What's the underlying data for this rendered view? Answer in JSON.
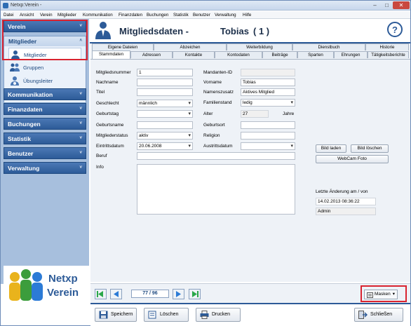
{
  "window": {
    "title": "Netxp:Verein -"
  },
  "menu": [
    "Datei",
    "Ansicht",
    "Verein",
    "Mitglieder",
    "Kommunikation",
    "Finanzdaten",
    "Buchungen",
    "Statistik",
    "Benutzer",
    "Verwaltung",
    "Hilfe"
  ],
  "sidebar": {
    "sections": [
      "Verein",
      "Mitglieder",
      "Kommunikation",
      "Finanzdaten",
      "Buchungen",
      "Statistik",
      "Benutzer",
      "Verwaltung"
    ],
    "mitglieder_items": [
      "Mitglieder",
      "Gruppen",
      "Übungsleiter"
    ],
    "chevron_up": "˄",
    "chevron_down": "˅"
  },
  "logo": {
    "line1": "Netxp",
    "line2": "Verein"
  },
  "header": {
    "title": "Mitgliedsdaten -",
    "name": "Tobias",
    "number": "( 1      )",
    "help": "?"
  },
  "tabs": {
    "row1": [
      "Eigene Dateien",
      "Abzeichen",
      "Weiterbildung",
      "Dienstbuch",
      "Historie"
    ],
    "row2": [
      "Stammdaten",
      "Adressen",
      "Kontakte",
      "Kontodaten",
      "Beiträge",
      "Sparten",
      "Ehrungen",
      "Tätigkeitsberichte"
    ],
    "active": "Stammdaten"
  },
  "form": {
    "left": {
      "mitgliedsnummer": {
        "label": "Mitgliedsnummer",
        "value": "1"
      },
      "nachname": {
        "label": "Nachname",
        "value": ""
      },
      "titel": {
        "label": "Titel",
        "value": ""
      },
      "geschlecht": {
        "label": "Geschlecht",
        "value": "männlich"
      },
      "geburtstag": {
        "label": "Geburtstag",
        "value": ""
      },
      "geburtsname": {
        "label": "Geburtsname",
        "value": ""
      },
      "mitgliederstatus": {
        "label": "Mitgliederstatus",
        "value": "aktiv"
      },
      "eintrittsdatum": {
        "label": "Eintrittsdatum",
        "value": "20.06.2008"
      },
      "beruf": {
        "label": "Beruf",
        "value": ""
      },
      "info": {
        "label": "Info",
        "value": ""
      }
    },
    "right": {
      "mandanten_id": {
        "label": "Mandanten-ID",
        "value": ""
      },
      "vorname": {
        "label": "Vorname",
        "value": "Tobias"
      },
      "namenszusatz": {
        "label": "Namenszusatz",
        "value": "Aktives Mitglied"
      },
      "familienstand": {
        "label": "Familienstand",
        "value": "ledig"
      },
      "alter": {
        "label": "Alter",
        "value": "27",
        "unit": "Jahre"
      },
      "geburtsort": {
        "label": "Geburtsort",
        "value": ""
      },
      "religion": {
        "label": "Religion",
        "value": ""
      },
      "austrittsdatum": {
        "label": "Austrittsdatum",
        "value": ""
      }
    },
    "photo_buttons": {
      "bild_laden": "Bild laden",
      "bild_loeschen": "Bild löschen",
      "webcam": "WebCam Foto"
    },
    "last_change": {
      "label": "Letzte Änderung am / von",
      "date": "14.02.2013 08:36:22",
      "user": "Admin"
    }
  },
  "navigation": {
    "record": "77 / 96",
    "masken": "Masken"
  },
  "buttons": {
    "speichern": "Speichern",
    "loeschen": "Löschen",
    "drucken": "Drucken",
    "schliessen": "Schließen"
  },
  "colors": {
    "accent": "#2d5b98",
    "sidebar": "#a7bfdd",
    "highlight": "#d9232f",
    "nav_green": "#2aa84a",
    "nav_blue": "#2c7bd6"
  }
}
